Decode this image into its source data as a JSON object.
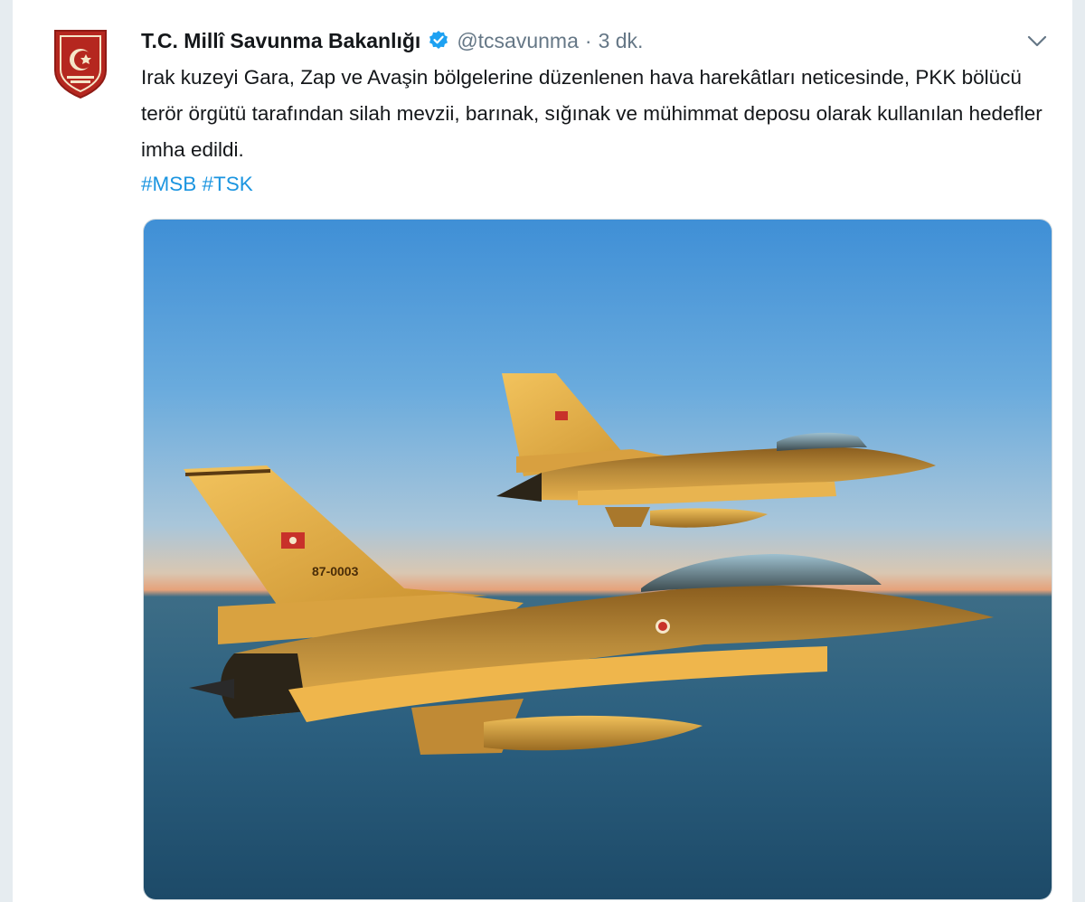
{
  "tweet": {
    "author_name": "T.C. Millî Savunma Bakanlığı",
    "handle": "@tcsavunma",
    "separator": "·",
    "time": "3 dk.",
    "text": "Irak kuzeyi Gara, Zap ve Avaşin bölgelerine düzenlenen hava harekâtları neticesinde, PKK bölücü terör örgütü tarafından silah mevzii, barınak, sığınak ve mühimmat deposu olarak kullanılan hedefler imha edildi.",
    "hashtags": [
      "#MSB",
      "#TSK"
    ]
  },
  "media": {
    "jet_rear_tail": "87-0003"
  },
  "icons": {
    "avatar": "msb-emblem-icon",
    "verified": "verified-badge-icon",
    "menu": "chevron-down-icon"
  },
  "colors": {
    "link": "#1b95e0",
    "verified": "#1da1f2",
    "emblem_red": "#b5271f",
    "text": "#14171a",
    "muted": "#657786"
  }
}
